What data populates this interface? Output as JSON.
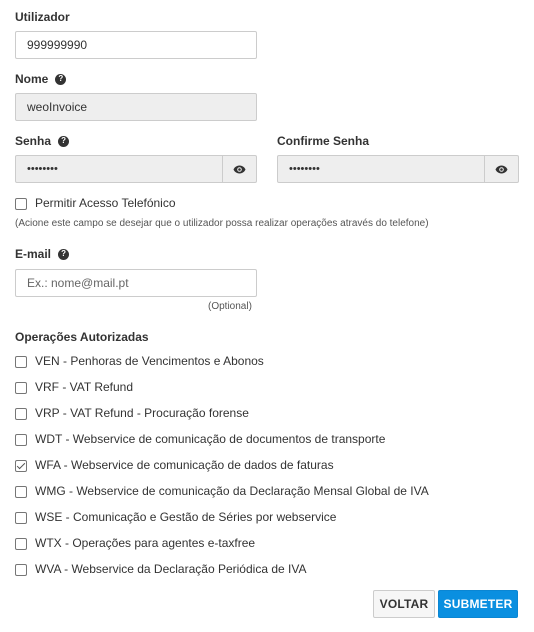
{
  "form": {
    "user": {
      "label": "Utilizador",
      "value": "999999990"
    },
    "name": {
      "label": "Nome",
      "value": "weoInvoice"
    },
    "password": {
      "label": "Senha",
      "value": "••••••••"
    },
    "confirm_password": {
      "label": "Confirme Senha",
      "value": "••••••••"
    },
    "phone_access": {
      "label": "Permitir Acesso Telefónico",
      "checked": false,
      "hint": "(Acione este campo se desejar que o utilizador possa realizar operações através do telefone)"
    },
    "email": {
      "label": "E-mail",
      "placeholder": "Ex.: nome@mail.pt",
      "optional": "(Optional)"
    },
    "operations": {
      "title": "Operações Autorizadas",
      "items": [
        {
          "label": "VEN - Penhoras de Vencimentos e Abonos",
          "checked": false
        },
        {
          "label": "VRF - VAT Refund",
          "checked": false
        },
        {
          "label": "VRP - VAT Refund - Procuração forense",
          "checked": false
        },
        {
          "label": "WDT - Webservice de comunicação de documentos de transporte",
          "checked": false
        },
        {
          "label": "WFA - Webservice de comunicação de dados de faturas",
          "checked": true
        },
        {
          "label": "WMG - Webservice de comunicação da Declaração Mensal Global de IVA",
          "checked": false
        },
        {
          "label": "WSE - Comunicação e Gestão de Séries por webservice",
          "checked": false
        },
        {
          "label": "WTX - Operações para agentes e-taxfree",
          "checked": false
        },
        {
          "label": "WVA - Webservice da Declaração Periódica de IVA",
          "checked": false
        }
      ]
    }
  },
  "buttons": {
    "back": "VOLTAR",
    "submit": "SUBMETER"
  },
  "colors": {
    "primary": "#0a8fe0",
    "readonly_bg": "#eeeeee",
    "border": "#cccccc"
  },
  "icons": {
    "help": "question-circle-icon",
    "eye": "eye-icon"
  }
}
